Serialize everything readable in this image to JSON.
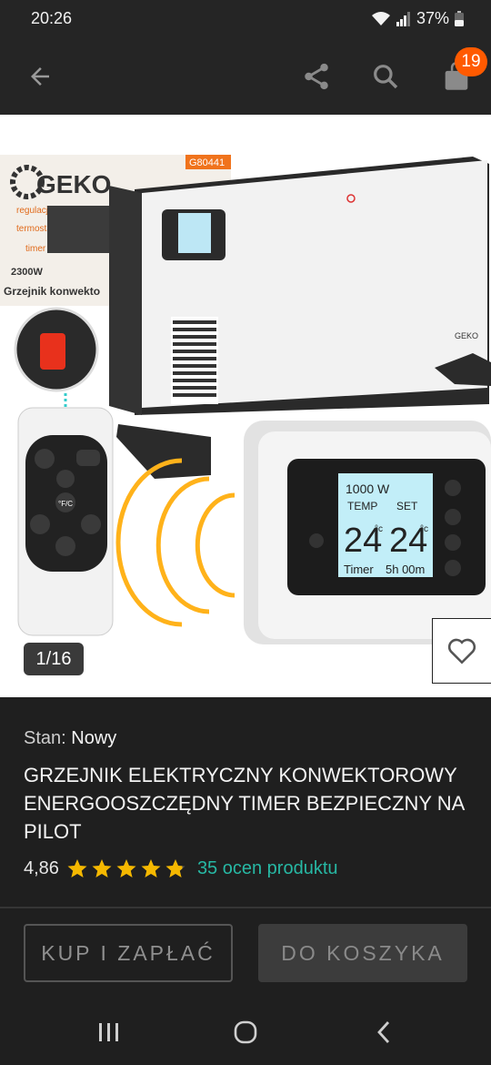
{
  "status": {
    "time": "20:26",
    "battery": "37%"
  },
  "toolbar": {
    "cart_count": "19"
  },
  "gallery": {
    "counter": "1/16",
    "brand": "GEKO",
    "model_code": "G80441",
    "features": [
      "regulacja",
      "termostat",
      "timer"
    ],
    "power": "2300W",
    "caption": "Grzejnik konwekto",
    "display": {
      "watts": "1000 W",
      "temp_label": "TEMP",
      "set_label": "SET",
      "temp": "24",
      "set": "24",
      "unit": "°c",
      "timer_label": "Timer",
      "timer_value": "5h 00m"
    },
    "remote_unit": "°F/C"
  },
  "product": {
    "condition_label": "Stan:",
    "condition_value": "Nowy",
    "title": "GRZEJNIK ELEKTRYCZNY KONWEKTOROWY ENERGOOSZCZĘDNY TIMER BEZPIECZNY NA PILOT",
    "rating": "4,86",
    "rating_stars": 4.86,
    "ratings_link": "35 ocen produktu"
  },
  "actions": {
    "buy_now": "KUP I ZAPŁAĆ",
    "add_to_cart": "DO KOSZYKA"
  },
  "colors": {
    "accent": "#27b8a4",
    "badge": "#ff5a00",
    "star": "#f5b800",
    "background": "#1f1f1f"
  }
}
